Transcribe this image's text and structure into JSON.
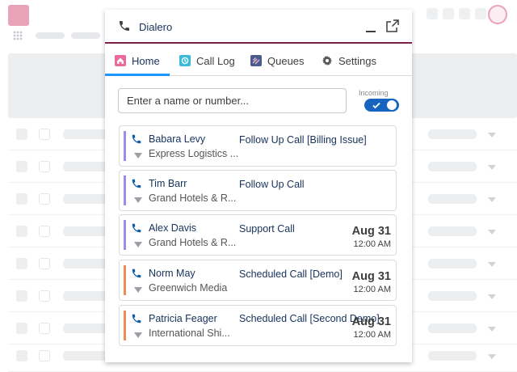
{
  "widget": {
    "title": "Dialero",
    "icons": {
      "phone": "phone-icon",
      "minimize": "minimize-icon",
      "popout": "popout-icon"
    },
    "accent": "#7a1f45"
  },
  "tabs": [
    {
      "label": "Home",
      "icon": "home-icon",
      "color": "#e8699a",
      "active": true
    },
    {
      "label": "Call Log",
      "icon": "call-log-icon",
      "color": "#3bbad9",
      "active": false
    },
    {
      "label": "Queues",
      "icon": "queues-icon",
      "color": "#4a5b8c",
      "active": false
    },
    {
      "label": "Settings",
      "icon": "gear-icon",
      "color": "#5a5a5a",
      "active": false
    }
  ],
  "search": {
    "placeholder": "Enter a name or number..."
  },
  "incoming": {
    "label": "Incoming",
    "enabled": true,
    "color": "#1565c0"
  },
  "calls": [
    {
      "name": "Babara Levy",
      "company": "Express Logistics ...",
      "subject": "Follow Up Call [Billing Issue]",
      "date": "",
      "time": "",
      "bar_color": "#9b8cf0"
    },
    {
      "name": "Tim Barr",
      "company": "Grand Hotels & R...",
      "subject": "Follow Up Call",
      "date": "",
      "time": "",
      "bar_color": "#9b8cf0"
    },
    {
      "name": "Alex Davis",
      "company": "Grand Hotels & R...",
      "subject": "Support Call",
      "date": "Aug 31",
      "time": "12:00 AM",
      "bar_color": "#9b8cf0"
    },
    {
      "name": "Norm May",
      "company": "Greenwich Media",
      "subject": "Scheduled Call [Demo]",
      "date": "Aug 31",
      "time": "12:00 AM",
      "bar_color": "#f08a5d"
    },
    {
      "name": "Patricia Feager",
      "company": "International Shi...",
      "subject": "Scheduled Call [Second Demo]",
      "date": "Aug 31",
      "time": "12:00 AM",
      "bar_color": "#f08a5d"
    }
  ]
}
